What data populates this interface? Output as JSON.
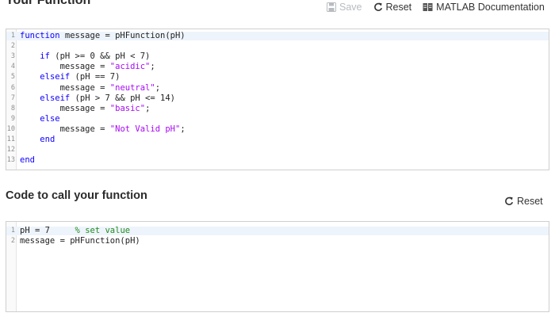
{
  "function_section": {
    "title": "Your Function",
    "toolbar": {
      "save_label": "Save",
      "reset_label": "Reset",
      "docs_label": "MATLAB Documentation"
    },
    "editor": {
      "lines": [
        {
          "num": "1",
          "segments": [
            {
              "t": "function",
              "c": "kw"
            },
            {
              "t": " message = pHFunction(pH)",
              "c": ""
            }
          ]
        },
        {
          "num": "2",
          "segments": []
        },
        {
          "num": "3",
          "segments": [
            {
              "t": "    ",
              "c": ""
            },
            {
              "t": "if",
              "c": "kw"
            },
            {
              "t": " (pH >= 0 && pH < 7)",
              "c": ""
            }
          ]
        },
        {
          "num": "4",
          "segments": [
            {
              "t": "        message = ",
              "c": ""
            },
            {
              "t": "\"acidic\"",
              "c": "str"
            },
            {
              "t": ";",
              "c": ""
            }
          ]
        },
        {
          "num": "5",
          "segments": [
            {
              "t": "    ",
              "c": ""
            },
            {
              "t": "elseif",
              "c": "kw"
            },
            {
              "t": " (pH == 7)",
              "c": ""
            }
          ]
        },
        {
          "num": "6",
          "segments": [
            {
              "t": "        message = ",
              "c": ""
            },
            {
              "t": "\"neutral\"",
              "c": "str"
            },
            {
              "t": ";",
              "c": ""
            }
          ]
        },
        {
          "num": "7",
          "segments": [
            {
              "t": "    ",
              "c": ""
            },
            {
              "t": "elseif",
              "c": "kw"
            },
            {
              "t": " (pH > 7 && pH <= 14)",
              "c": ""
            }
          ]
        },
        {
          "num": "8",
          "segments": [
            {
              "t": "        message = ",
              "c": ""
            },
            {
              "t": "\"basic\"",
              "c": "str"
            },
            {
              "t": ";",
              "c": ""
            }
          ]
        },
        {
          "num": "9",
          "segments": [
            {
              "t": "    ",
              "c": ""
            },
            {
              "t": "else",
              "c": "kw"
            }
          ]
        },
        {
          "num": "10",
          "segments": [
            {
              "t": "        message = ",
              "c": ""
            },
            {
              "t": "\"Not Valid pH\"",
              "c": "str"
            },
            {
              "t": ";",
              "c": ""
            }
          ]
        },
        {
          "num": "11",
          "segments": [
            {
              "t": "    ",
              "c": ""
            },
            {
              "t": "end",
              "c": "kw"
            }
          ]
        },
        {
          "num": "12",
          "segments": []
        },
        {
          "num": "13",
          "segments": [
            {
              "t": "end",
              "c": "kw"
            }
          ]
        }
      ]
    }
  },
  "call_section": {
    "title": "Code to call your function",
    "toolbar": {
      "reset_label": "Reset"
    },
    "editor": {
      "lines": [
        {
          "num": "1",
          "segments": [
            {
              "t": "pH = 7     ",
              "c": ""
            },
            {
              "t": "% set value",
              "c": "cmt"
            }
          ]
        },
        {
          "num": "2",
          "segments": [
            {
              "t": "message = pHFunction(pH)",
              "c": ""
            }
          ]
        }
      ]
    }
  },
  "colors": {
    "keyword": "#0e00ff",
    "string": "#a709f5",
    "comment": "#228b22"
  },
  "icons": {
    "save": "save-icon",
    "reset": "reset-icon",
    "docs": "documentation-icon"
  }
}
